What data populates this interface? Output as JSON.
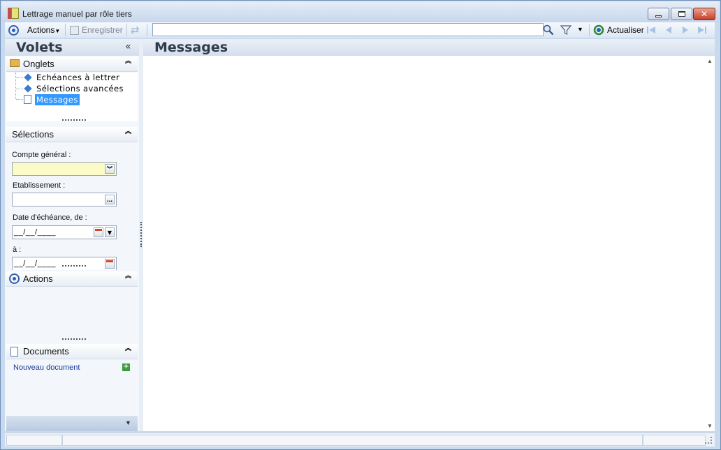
{
  "window": {
    "title": "Lettrage manuel par rôle tiers"
  },
  "toolbar": {
    "actions_label": "Actions",
    "save_label": "Enregistrer",
    "search_value": "",
    "refresh_label": "Actualiser"
  },
  "left_panel": {
    "title": "Volets",
    "onglets": {
      "title": "Onglets",
      "items": [
        {
          "label": "Echéances à lettrer"
        },
        {
          "label": "Sélections avancées"
        },
        {
          "label": "Messages",
          "selected": true
        }
      ]
    },
    "selections": {
      "title": "Sélections",
      "compte_general_label": "Compte général :",
      "etablissement_label": "Etablissement :",
      "date_from_label": "Date d'échéance, de :",
      "date_from_value": "__/__/____",
      "date_to_label": "à :",
      "date_to_value": "__/__/____"
    },
    "actions": {
      "title": "Actions"
    },
    "documents": {
      "title": "Documents",
      "new_document_label": "Nouveau document"
    }
  },
  "main": {
    "title": "Messages"
  },
  "colors": {
    "accent": "#3399ff",
    "link": "#1a3b98",
    "header_text": "#303a48"
  }
}
